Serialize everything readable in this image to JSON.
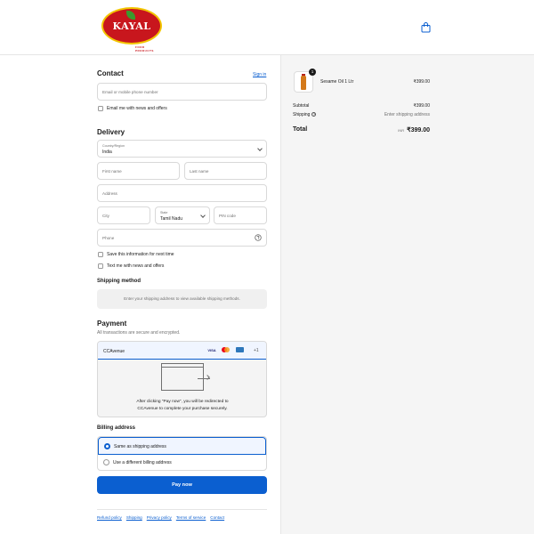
{
  "brand": {
    "name": "KAYAL",
    "tagline": "FOOD PRODUCTS",
    "color": "#c8161d"
  },
  "header": {
    "cart_icon": "shopping-bag-icon"
  },
  "contact": {
    "title": "Contact",
    "sign_in": "Sign in",
    "email_placeholder": "Email or mobile phone number",
    "news_offers": "Email me with news and offers"
  },
  "delivery": {
    "title": "Delivery",
    "country_label": "Country/Region",
    "country_value": "India",
    "first_name": "First name",
    "last_name": "Last name",
    "address": "Address",
    "city": "City",
    "state_label": "State",
    "state_value": "Tamil Nadu",
    "pin": "PIN code",
    "phone": "Phone",
    "save_info": "Save this information for next time",
    "text_offers": "Text me with news and offers"
  },
  "shipping": {
    "title": "Shipping method",
    "message": "Enter your shipping address to view available shipping methods."
  },
  "payment": {
    "title": "Payment",
    "subtitle": "All transactions are secure and encrypted.",
    "method": "CCAvenue",
    "visa": "VISA",
    "more": "+1",
    "redirect_line1": "After clicking “Pay now”, you will be redirected to",
    "redirect_line2": "CCAvenue to complete your purchase securely."
  },
  "billing": {
    "title": "Billing address",
    "option_same": "Same as shipping address",
    "option_different": "Use a different billing address"
  },
  "pay_now": "Pay now",
  "footer": {
    "links": [
      "Refund policy",
      "Shipping",
      "Privacy policy",
      "Terms of service",
      "Contact"
    ]
  },
  "summary": {
    "item_name": "Sesame Oil 1 Ltr",
    "item_qty": "1",
    "item_price": "₹399.00",
    "subtotal_label": "Subtotal",
    "subtotal_value": "₹399.00",
    "shipping_label": "Shipping",
    "shipping_value": "Enter shipping address",
    "total_label": "Total",
    "currency": "INR",
    "total_value": "₹399.00"
  },
  "colors": {
    "accent": "#0b5fd0",
    "panel": "#f5f5f5"
  }
}
